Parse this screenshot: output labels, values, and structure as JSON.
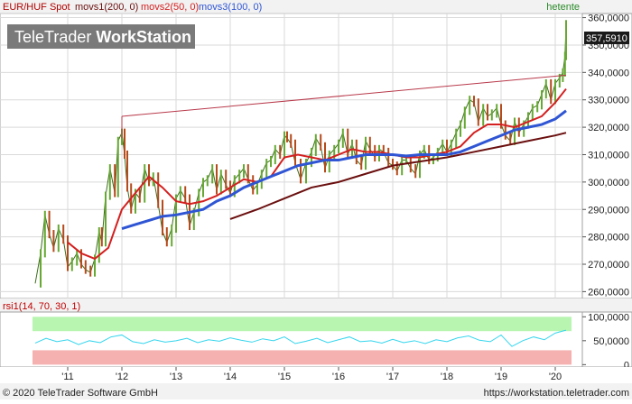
{
  "chart_data": [
    {
      "type": "line",
      "panel": "price",
      "header": {
        "symbol": "EUR/HUF Spot",
        "studies": [
          "movs1(200, 0)",
          "movs2(50, 0)",
          "movs3(100, 0)"
        ],
        "interval": "hetente"
      },
      "watermark": "TeleTrader WorkStation",
      "watermark_parts": [
        "TeleTrader",
        "WorkStation"
      ],
      "last_value_label": "357,5910",
      "y_tick_labels": [
        "260,0000",
        "270,0000",
        "280,0000",
        "290,0000",
        "300,0000",
        "310,0000",
        "320,0000",
        "330,0000",
        "340,0000",
        "350,0000",
        "360,0000"
      ],
      "y_ticks": [
        260,
        270,
        280,
        290,
        300,
        310,
        320,
        330,
        340,
        350,
        360
      ],
      "ylim": [
        257.5,
        361.5
      ],
      "x_tick_labels": [
        "'11",
        "'12",
        "'13",
        "'14",
        "'15",
        "'16",
        "'17",
        "'18",
        "'19",
        "'20"
      ],
      "x_ticks": [
        2011,
        2012,
        2013,
        2014,
        2015,
        2016,
        2017,
        2018,
        2019,
        2020
      ],
      "xlim": [
        2009.75,
        2020.5
      ],
      "grid": true,
      "colors": {
        "price": "#3d6b1e",
        "price_up": "#66a832",
        "price_down": "#b54a1a",
        "movs1": "#6b0f0f",
        "movs2": "#d42020",
        "movs3": "#2f55d4",
        "trendline": "#b8394a",
        "grid": "#d9d9d9"
      },
      "series": [
        {
          "key": "price",
          "x": [
            2010.4,
            2010.5,
            2010.58,
            2010.66,
            2010.74,
            2010.83,
            2010.92,
            2011.0,
            2011.08,
            2011.17,
            2011.25,
            2011.33,
            2011.42,
            2011.5,
            2011.58,
            2011.63,
            2011.7,
            2011.78,
            2011.87,
            2011.93,
            2012.0,
            2012.05,
            2012.1,
            2012.17,
            2012.25,
            2012.33,
            2012.42,
            2012.5,
            2012.58,
            2012.67,
            2012.75,
            2012.83,
            2012.92,
            2013.0,
            2013.08,
            2013.17,
            2013.25,
            2013.33,
            2013.42,
            2013.5,
            2013.58,
            2013.67,
            2013.75,
            2013.83,
            2013.92,
            2014.0,
            2014.08,
            2014.17,
            2014.25,
            2014.33,
            2014.42,
            2014.5,
            2014.58,
            2014.67,
            2014.75,
            2014.83,
            2014.92,
            2015.0,
            2015.05,
            2015.12,
            2015.2,
            2015.3,
            2015.4,
            2015.5,
            2015.58,
            2015.67,
            2015.75,
            2015.83,
            2015.92,
            2016.0,
            2016.08,
            2016.17,
            2016.25,
            2016.33,
            2016.42,
            2016.5,
            2016.58,
            2016.67,
            2016.75,
            2016.83,
            2016.92,
            2017.0,
            2017.08,
            2017.17,
            2017.25,
            2017.33,
            2017.42,
            2017.5,
            2017.58,
            2017.67,
            2017.75,
            2017.83,
            2017.92,
            2018.0,
            2018.08,
            2018.17,
            2018.25,
            2018.33,
            2018.42,
            2018.5,
            2018.58,
            2018.67,
            2018.75,
            2018.83,
            2018.92,
            2019.0,
            2019.08,
            2019.17,
            2019.25,
            2019.33,
            2019.42,
            2019.5,
            2019.58,
            2019.67,
            2019.75,
            2019.83,
            2019.92,
            2020.0,
            2020.08,
            2020.14,
            2020.18,
            2020.2
          ],
          "y": [
            263,
            274,
            288,
            281,
            276,
            283,
            279,
            269,
            271,
            274,
            270,
            268,
            267,
            272,
            282,
            278,
            295,
            305,
            296,
            315,
            318,
            310,
            298,
            290,
            296,
            294,
            305,
            300,
            302,
            292,
            282,
            278,
            283,
            294,
            297,
            294,
            284,
            289,
            296,
            300,
            301,
            305,
            297,
            303,
            299,
            296,
            301,
            303,
            305,
            301,
            297,
            299,
            303,
            307,
            308,
            312,
            310,
            317,
            316,
            314,
            307,
            301,
            307,
            311,
            316,
            313,
            305,
            310,
            312,
            314,
            318,
            310,
            314,
            308,
            306,
            315,
            312,
            309,
            312,
            311,
            307,
            306,
            304,
            308,
            308,
            305,
            303,
            310,
            312,
            308,
            309,
            311,
            314,
            311,
            314,
            318,
            321,
            326,
            330,
            329,
            322,
            327,
            324,
            325,
            327,
            321,
            317,
            315,
            322,
            318,
            321,
            324,
            327,
            328,
            332,
            336,
            330,
            336,
            338,
            340,
            346,
            357.6
          ]
        },
        {
          "key": "movs1",
          "x": [
            2014.0,
            2014.5,
            2015.0,
            2015.5,
            2016.0,
            2016.5,
            2017.0,
            2017.5,
            2018.0,
            2018.5,
            2019.0,
            2019.5,
            2020.0,
            2020.2
          ],
          "y": [
            286.5,
            290,
            294,
            298,
            300,
            303,
            306,
            307.5,
            309,
            311,
            313,
            315,
            317,
            318
          ]
        },
        {
          "key": "movs2",
          "x": [
            2011.0,
            2011.25,
            2011.5,
            2011.75,
            2012.0,
            2012.25,
            2012.5,
            2012.75,
            2013.0,
            2013.25,
            2013.5,
            2013.75,
            2014.0,
            2014.25,
            2014.5,
            2014.75,
            2015.0,
            2015.25,
            2015.5,
            2015.75,
            2016.0,
            2016.25,
            2016.5,
            2016.75,
            2017.0,
            2017.25,
            2017.5,
            2017.75,
            2018.0,
            2018.25,
            2018.5,
            2018.75,
            2019.0,
            2019.25,
            2019.5,
            2019.75,
            2020.0,
            2020.2
          ],
          "y": [
            278,
            274,
            272,
            276,
            290,
            296,
            302,
            298,
            293,
            292,
            293,
            295,
            298,
            301,
            300,
            302,
            309,
            310,
            309,
            308,
            310,
            312,
            311,
            311,
            310,
            309,
            309,
            310,
            311,
            313,
            318,
            321,
            321,
            320,
            322,
            324,
            329,
            334
          ]
        },
        {
          "key": "movs3",
          "x": [
            2012.0,
            2012.25,
            2012.5,
            2012.75,
            2013.0,
            2013.25,
            2013.5,
            2013.75,
            2014.0,
            2014.25,
            2014.5,
            2014.75,
            2015.0,
            2015.25,
            2015.5,
            2015.75,
            2016.0,
            2016.25,
            2016.5,
            2016.75,
            2017.0,
            2017.25,
            2017.5,
            2017.75,
            2018.0,
            2018.25,
            2018.5,
            2018.75,
            2019.0,
            2019.25,
            2019.5,
            2019.75,
            2020.0,
            2020.2
          ],
          "y": [
            283,
            284.5,
            286,
            287.5,
            288,
            289,
            290,
            293,
            295,
            298,
            300,
            302,
            304,
            306,
            307,
            308,
            308,
            309,
            310,
            310,
            310,
            309.5,
            310,
            310,
            310,
            311,
            313,
            315,
            317,
            319,
            320,
            321,
            323,
            326
          ]
        },
        {
          "key": "trendline",
          "x": [
            2012.0,
            2020.2
          ],
          "y": [
            324,
            339
          ]
        }
      ]
    },
    {
      "type": "line",
      "panel": "rsi",
      "header": {
        "study": "rsi1(14, 70, 30, 1)"
      },
      "y_tick_labels": [
        "0",
        "50,0000",
        "100,0000"
      ],
      "y_ticks": [
        0,
        50,
        100
      ],
      "ylim": [
        -5,
        110
      ],
      "overbought": 70,
      "oversold": 30,
      "colors": {
        "line": "#33d6ee",
        "overbought_zone": "#b8f5b0",
        "oversold_zone": "#f5b0b0"
      },
      "series": [
        {
          "key": "rsi",
          "x": [
            2010.4,
            2010.6,
            2010.8,
            2011.0,
            2011.2,
            2011.4,
            2011.6,
            2011.8,
            2012.0,
            2012.2,
            2012.4,
            2012.6,
            2012.8,
            2013.0,
            2013.2,
            2013.4,
            2013.6,
            2013.8,
            2014.0,
            2014.2,
            2014.4,
            2014.6,
            2014.8,
            2015.0,
            2015.2,
            2015.4,
            2015.6,
            2015.8,
            2016.0,
            2016.2,
            2016.4,
            2016.6,
            2016.8,
            2017.0,
            2017.2,
            2017.4,
            2017.6,
            2017.8,
            2018.0,
            2018.2,
            2018.4,
            2018.6,
            2018.8,
            2019.0,
            2019.2,
            2019.4,
            2019.6,
            2019.8,
            2020.0,
            2020.2
          ],
          "y": [
            45,
            55,
            48,
            52,
            42,
            50,
            46,
            58,
            62,
            48,
            44,
            52,
            47,
            50,
            55,
            46,
            52,
            49,
            56,
            51,
            47,
            54,
            50,
            58,
            44,
            49,
            55,
            46,
            52,
            58,
            48,
            50,
            45,
            53,
            46,
            50,
            44,
            52,
            48,
            56,
            60,
            51,
            48,
            62,
            38,
            50,
            58,
            52,
            66,
            72
          ]
        }
      ]
    }
  ],
  "footer": {
    "copyright": "© 2020 TeleTrader Software GmbH",
    "url": "https://workstation.teletrader.com"
  }
}
